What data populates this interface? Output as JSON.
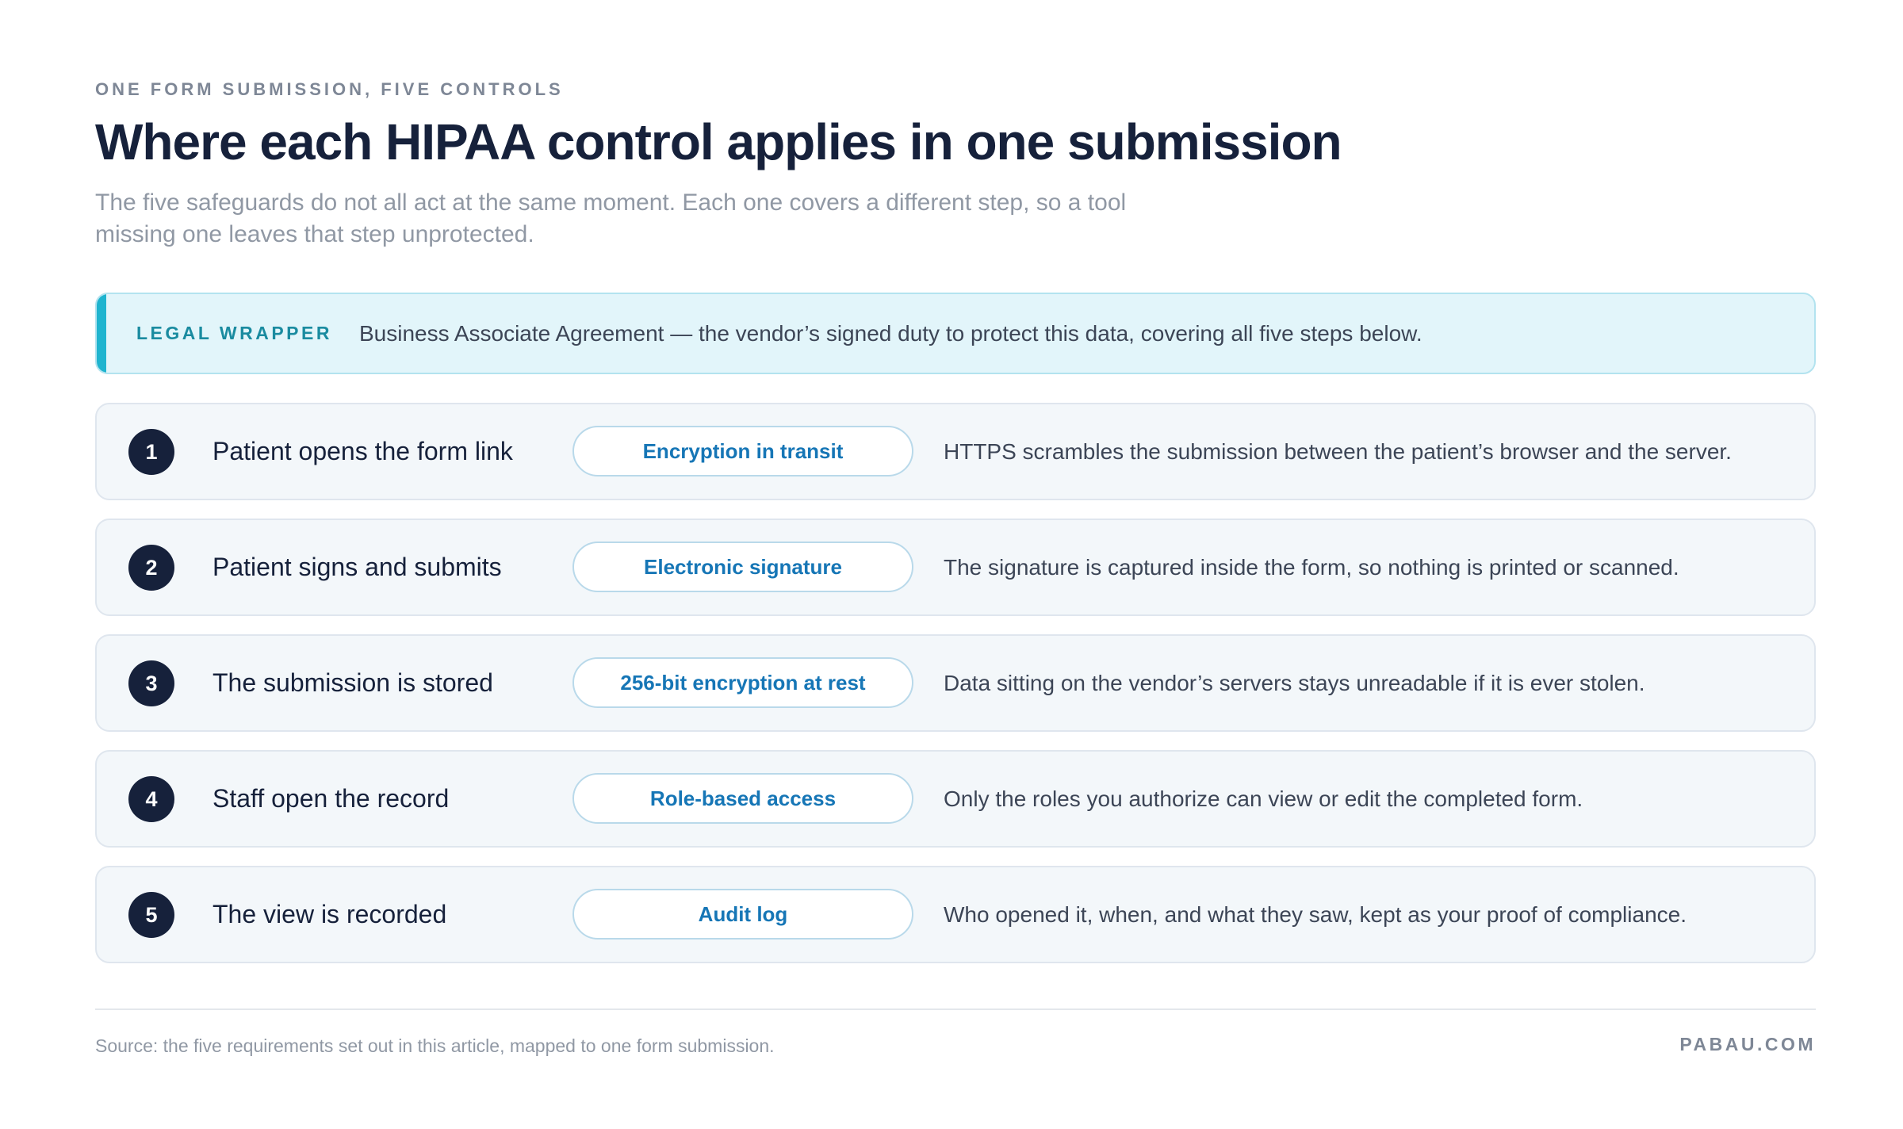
{
  "header": {
    "eyebrow": "ONE FORM SUBMISSION, FIVE CONTROLS",
    "title": "Where each HIPAA control applies in one submission",
    "subtitle": "The five safeguards do not all act at the same moment. Each one covers a different step, so a tool missing one leaves that step unprotected."
  },
  "legal_wrapper": {
    "tag": "LEGAL WRAPPER",
    "text": "Business Associate Agreement — the vendor’s signed duty to protect this data, covering all five steps below."
  },
  "steps": [
    {
      "number": "1",
      "step": "Patient opens the form link",
      "control": "Encryption in transit",
      "description": "HTTPS scrambles the submission between the patient’s browser and the server."
    },
    {
      "number": "2",
      "step": "Patient signs and submits",
      "control": "Electronic signature",
      "description": "The signature is captured inside the form, so nothing is printed or scanned."
    },
    {
      "number": "3",
      "step": "The submission is stored",
      "control": "256-bit encryption at rest",
      "description": "Data sitting on the vendor’s servers stays unreadable if it is ever stolen."
    },
    {
      "number": "4",
      "step": "Staff open the record",
      "control": "Role-based access",
      "description": "Only the roles you authorize can view or edit the completed form."
    },
    {
      "number": "5",
      "step": "The view is recorded",
      "control": "Audit log",
      "description": "Who opened it, when, and what they saw, kept as your proof of compliance."
    }
  ],
  "footer": {
    "source": "Source: the five requirements set out in this article, mapped to one form submission.",
    "brand": "PABAU.COM"
  },
  "colors": {
    "navy": "#16213b",
    "accent_teal": "#1fb4cf",
    "control_blue": "#1676b6",
    "legal_background": "#e2f5fa"
  }
}
